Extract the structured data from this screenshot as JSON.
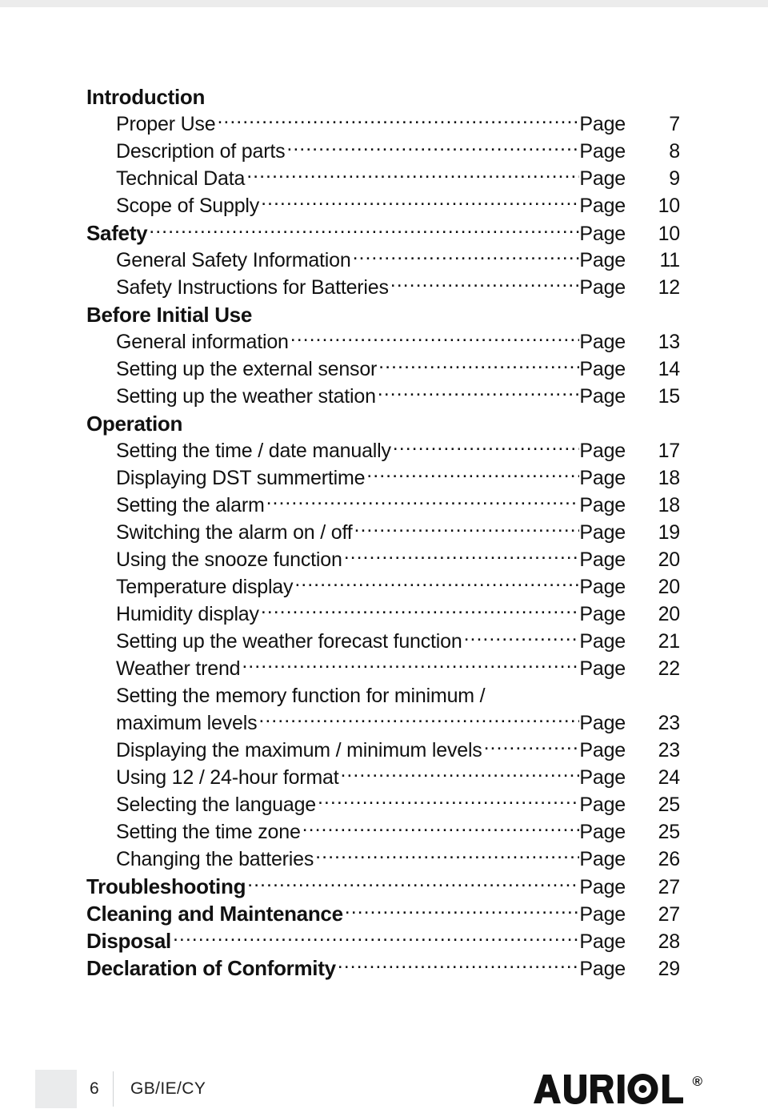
{
  "document": {
    "type": "table-of-contents",
    "brand": "AURIOL",
    "registered_mark": "®",
    "page_label_word": "Page"
  },
  "toc": {
    "rows": [
      {
        "kind": "heading",
        "title": "Introduction",
        "page_label": "",
        "page": ""
      },
      {
        "kind": "entry",
        "title": "Proper Use",
        "page_label": "Page",
        "page": "7"
      },
      {
        "kind": "entry",
        "title": "Description of parts",
        "page_label": "Page",
        "page": "8"
      },
      {
        "kind": "entry",
        "title": "Technical Data",
        "page_label": "Page",
        "page": "9"
      },
      {
        "kind": "entry",
        "title": "Scope of Supply",
        "page_label": "Page",
        "page": "10"
      },
      {
        "kind": "heading",
        "title": "Safety",
        "page_label": "Page",
        "page": "10"
      },
      {
        "kind": "entry",
        "title": "General Safety Information",
        "page_label": "Page",
        "page": "11"
      },
      {
        "kind": "entry",
        "title": "Safety Instructions for Batteries",
        "page_label": "Page",
        "page": "12"
      },
      {
        "kind": "heading",
        "title": "Before Initial Use",
        "page_label": "",
        "page": ""
      },
      {
        "kind": "entry",
        "title": "General information",
        "page_label": "Page",
        "page": "13"
      },
      {
        "kind": "entry",
        "title": "Setting up the external sensor",
        "page_label": "Page",
        "page": "14"
      },
      {
        "kind": "entry",
        "title": "Setting up the weather station",
        "page_label": "Page",
        "page": "15"
      },
      {
        "kind": "heading",
        "title": "Operation",
        "page_label": "",
        "page": ""
      },
      {
        "kind": "entry",
        "title": "Setting the time / date manually",
        "page_label": "Page",
        "page": "17"
      },
      {
        "kind": "entry",
        "title": "Displaying DST summertime",
        "page_label": "Page",
        "page": "18"
      },
      {
        "kind": "entry",
        "title": "Setting the alarm",
        "page_label": "Page",
        "page": "18"
      },
      {
        "kind": "entry",
        "title": "Switching the alarm on / off",
        "page_label": "Page",
        "page": "19"
      },
      {
        "kind": "entry",
        "title": "Using the snooze function",
        "page_label": "Page",
        "page": "20"
      },
      {
        "kind": "entry",
        "title": "Temperature display",
        "page_label": "Page",
        "page": "20"
      },
      {
        "kind": "entry",
        "title": "Humidity display",
        "page_label": "Page",
        "page": "20"
      },
      {
        "kind": "entry",
        "title": "Setting up the weather forecast function",
        "page_label": "Page",
        "page": "21"
      },
      {
        "kind": "entry",
        "title": "Weather trend",
        "page_label": "Page",
        "page": "22"
      },
      {
        "kind": "wrap",
        "title": "Setting the memory function for minimum /",
        "page_label": "",
        "page": ""
      },
      {
        "kind": "cont",
        "title": "maximum levels",
        "page_label": "Page",
        "page": "23"
      },
      {
        "kind": "entry",
        "title": "Displaying the maximum / minimum levels",
        "page_label": "Page",
        "page": "23"
      },
      {
        "kind": "entry",
        "title": "Using 12 / 24-hour format",
        "page_label": "Page",
        "page": "24"
      },
      {
        "kind": "entry",
        "title": "Selecting the language",
        "page_label": "Page",
        "page": "25"
      },
      {
        "kind": "entry",
        "title": "Setting the time zone",
        "page_label": "Page",
        "page": "25"
      },
      {
        "kind": "entry",
        "title": "Changing the batteries",
        "page_label": "Page",
        "page": "26"
      },
      {
        "kind": "heading",
        "title": "Troubleshooting",
        "page_label": "Page",
        "page": "27"
      },
      {
        "kind": "heading",
        "title": "Cleaning and Maintenance",
        "page_label": "Page",
        "page": "27"
      },
      {
        "kind": "heading",
        "title": "Disposal",
        "page_label": "Page",
        "page": "28"
      },
      {
        "kind": "heading",
        "title": "Declaration of Conformity",
        "page_label": "Page",
        "page": "29"
      }
    ]
  },
  "footer": {
    "page_number": "6",
    "locale": "GB/IE/CY",
    "brand": "AURIOL",
    "registered_mark": "®"
  }
}
